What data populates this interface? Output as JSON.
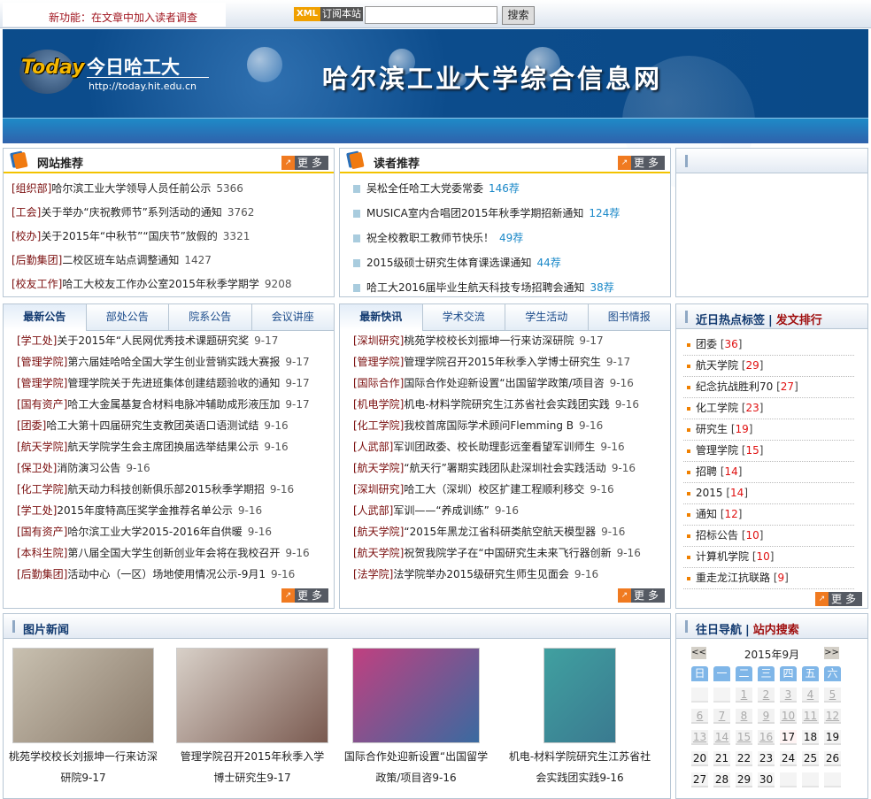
{
  "topbar": {
    "notice": "新功能：在文章中加入读者调查",
    "xml_badge": "XML",
    "subscribe": "订阅本站",
    "search_value": "",
    "search_button": "搜索"
  },
  "banner": {
    "logo": "Today",
    "brand": "今日哈工大",
    "url": "http://today.hit.edu.cn",
    "title": "哈尔滨工业大学综合信息网"
  },
  "more_label": "更多",
  "site_recommend": {
    "title": "网站推荐",
    "items": [
      {
        "tag": "[组织部]",
        "title": "哈尔滨工业大学领导人员任前公示",
        "count": "5366"
      },
      {
        "tag": "[工会]",
        "title": "关于举办“庆祝教师节”系列活动的通知",
        "count": "3762"
      },
      {
        "tag": "[校办]",
        "title": "关于2015年“中秋节”“国庆节”放假的",
        "count": "3321"
      },
      {
        "tag": "[后勤集团]",
        "title": "二校区班车站点调整通知",
        "count": "1427"
      },
      {
        "tag": "[校友工作]",
        "title": "哈工大校友工作办公室2015年秋季学期学",
        "count": "9208"
      }
    ]
  },
  "reader_recommend": {
    "title": "读者推荐",
    "items": [
      {
        "title": "吴松全任哈工大党委常委",
        "count": "146荐"
      },
      {
        "title": "MUSICA室内合唱团2015年秋季学期招新通知",
        "count": "124荐"
      },
      {
        "title": "祝全校教职工教师节快乐！",
        "count": "49荐"
      },
      {
        "title": "2015级硕士研究生体育课选课通知",
        "count": "44荐"
      },
      {
        "title": "哈工大2016届毕业生航天科技专场招聘会通知",
        "count": "38荐"
      }
    ]
  },
  "announcements": {
    "tabs": [
      "最新公告",
      "部处公告",
      "院系公告",
      "会议讲座"
    ],
    "items": [
      {
        "tag": "[学工处]",
        "title": "关于2015年“人民网优秀技术课题研究奖",
        "date": "9-17"
      },
      {
        "tag": "[管理学院]",
        "title": "第六届娃哈哈全国大学生创业营销实践大赛报",
        "date": "9-17"
      },
      {
        "tag": "[管理学院]",
        "title": "管理学院关于先进班集体创建结题验收的通知",
        "date": "9-17"
      },
      {
        "tag": "[国有资产]",
        "title": "哈工大金属基复合材料电脉冲辅助成形液压加",
        "date": "9-17"
      },
      {
        "tag": "[团委]",
        "title": "哈工大第十四届研究生支教团英语口语测试结",
        "date": "9-16"
      },
      {
        "tag": "[航天学院]",
        "title": "航天学院学生会主席团换届选举结果公示",
        "date": "9-16"
      },
      {
        "tag": "[保卫处]",
        "title": "消防演习公告",
        "date": "9-16"
      },
      {
        "tag": "[化工学院]",
        "title": "航天动力科技创新俱乐部2015秋季学期招",
        "date": "9-16"
      },
      {
        "tag": "[学工处]",
        "title": "2015年度特高压奖学金推荐名单公示",
        "date": "9-16"
      },
      {
        "tag": "[国有资产]",
        "title": "哈尔滨工业大学2015-2016年自供暖",
        "date": "9-16"
      },
      {
        "tag": "[本科生院]",
        "title": "第八届全国大学生创新创业年会将在我校召开",
        "date": "9-16"
      },
      {
        "tag": "[后勤集团]",
        "title": "活动中心（一区）场地使用情况公示-9月1",
        "date": "9-16"
      }
    ]
  },
  "news": {
    "tabs": [
      "最新快讯",
      "学术交流",
      "学生活动",
      "图书情报"
    ],
    "items": [
      {
        "tag": "[深圳研究]",
        "title": "桃苑学校校长刘振坤一行来访深研院",
        "date": "9-17"
      },
      {
        "tag": "[管理学院]",
        "title": "管理学院召开2015年秋季入学博士研究生",
        "date": "9-17"
      },
      {
        "tag": "[国际合作]",
        "title": "国际合作处迎新设置“出国留学政策/项目咨",
        "date": "9-16"
      },
      {
        "tag": "[机电学院]",
        "title": "机电-材料学院研究生江苏省社会实践团实践",
        "date": "9-16"
      },
      {
        "tag": "[化工学院]",
        "title": "我校首席国际学术顾问Flemming B",
        "date": "9-16"
      },
      {
        "tag": "[人武部]",
        "title": "军训团政委、校长助理彭远奎看望军训师生",
        "date": "9-16"
      },
      {
        "tag": "[航天学院]",
        "title": "“航天行”署期实践团队赴深圳社会实践活动",
        "date": "9-16"
      },
      {
        "tag": "[深圳研究]",
        "title": "哈工大（深圳）校区扩建工程顺利移交",
        "date": "9-16"
      },
      {
        "tag": "[人武部]",
        "title": "军训——“养成训练”",
        "date": "9-16"
      },
      {
        "tag": "[航天学院]",
        "title": "“2015年黑龙江省科研类航空航天模型器",
        "date": "9-16"
      },
      {
        "tag": "[航天学院]",
        "title": "祝贺我院学子在“中国研究生未来飞行器创新",
        "date": "9-16"
      },
      {
        "tag": "[法学院]",
        "title": "法学院举办2015级研究生师生见面会",
        "date": "9-16"
      }
    ]
  },
  "hot_tags": {
    "title": "近日热点标签",
    "title2": "发文排行",
    "items": [
      {
        "name": "团委",
        "count": "36"
      },
      {
        "name": "航天学院",
        "count": "29"
      },
      {
        "name": "纪念抗战胜利70",
        "count": "27"
      },
      {
        "name": "化工学院",
        "count": "23"
      },
      {
        "name": "研究生",
        "count": "19"
      },
      {
        "name": "管理学院",
        "count": "15"
      },
      {
        "name": "招聘",
        "count": "14"
      },
      {
        "name": "2015",
        "count": "14"
      },
      {
        "name": "通知",
        "count": "12"
      },
      {
        "name": "招标公告",
        "count": "10"
      },
      {
        "name": "计算机学院",
        "count": "10"
      },
      {
        "name": "重走龙江抗联路",
        "count": "9"
      }
    ]
  },
  "photo_news": {
    "title": "图片新闻",
    "items": [
      {
        "caption1": "桃苑学校校长刘振坤一行来访深",
        "caption2": "研院9-17"
      },
      {
        "caption1": "管理学院召开2015年秋季入学",
        "caption2": "博士研究生9-17"
      },
      {
        "caption1": "国际合作处迎新设置“出国留学",
        "caption2": "政策/项目咨9-16"
      },
      {
        "caption1": "机电-材料学院研究生江苏省社",
        "caption2": "会实践团实践9-16"
      }
    ]
  },
  "calendar": {
    "title": "往日导航",
    "title2": "站内搜索",
    "prev": "<<",
    "next": ">>",
    "month": "2015年9月",
    "weekdays": [
      "日",
      "一",
      "二",
      "三",
      "四",
      "五",
      "六"
    ],
    "days": [
      "",
      "",
      "1",
      "2",
      "3",
      "4",
      "5",
      "6",
      "7",
      "8",
      "9",
      "10",
      "11",
      "12",
      "13",
      "14",
      "15",
      "16",
      "17",
      "18",
      "19",
      "20",
      "21",
      "22",
      "23",
      "24",
      "25",
      "26",
      "27",
      "28",
      "29",
      "30",
      "",
      "",
      ""
    ],
    "today": "17"
  },
  "colors": {
    "banner": "#0a4a88",
    "accent_yellow": "#f3c300",
    "tag_red": "#7a0d0d",
    "count_blue": "#1a88c8",
    "hot_red": "#e01010"
  }
}
